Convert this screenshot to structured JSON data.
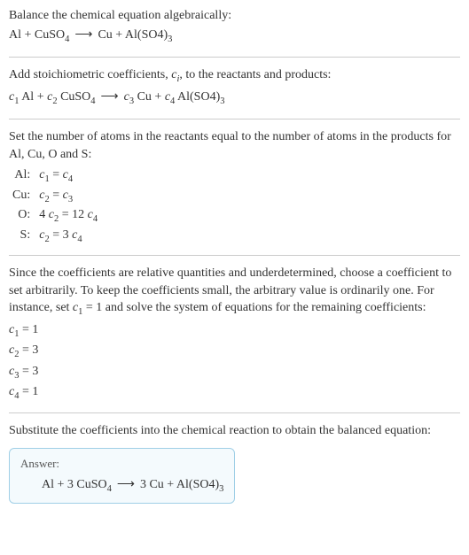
{
  "section1": {
    "heading": "Balance the chemical equation algebraically:",
    "equation": "Al + CuSO₄  ⟶  Cu + Al(SO4)₃"
  },
  "section2": {
    "heading": "Add stoichiometric coefficients, cᵢ, to the reactants and products:",
    "equation": "c₁ Al + c₂ CuSO₄  ⟶  c₃ Cu + c₄ Al(SO4)₃"
  },
  "section3": {
    "heading": "Set the number of atoms in the reactants equal to the number of atoms in the products for Al, Cu, O and S:",
    "rows": {
      "al_label": "Al:",
      "al_eq": "c₁ = c₄",
      "cu_label": "Cu:",
      "cu_eq": "c₂ = c₃",
      "o_label": "O:",
      "o_eq": "4 c₂ = 12 c₄",
      "s_label": "S:",
      "s_eq": "c₂ = 3 c₄"
    }
  },
  "section4": {
    "heading": "Since the coefficients are relative quantities and underdetermined, choose a coefficient to set arbitrarily. To keep the coefficients small, the arbitrary value is ordinarily one. For instance, set c₁ = 1 and solve the system of equations for the remaining coefficients:",
    "c1": "c₁ = 1",
    "c2": "c₂ = 3",
    "c3": "c₃ = 3",
    "c4": "c₄ = 1"
  },
  "section5": {
    "heading": "Substitute the coefficients into the chemical reaction to obtain the balanced equation:",
    "answer_label": "Answer:",
    "answer_eq": "Al + 3 CuSO₄  ⟶  3 Cu + Al(SO4)₃"
  },
  "unicode": {
    "sub_i": "ᵢ"
  }
}
